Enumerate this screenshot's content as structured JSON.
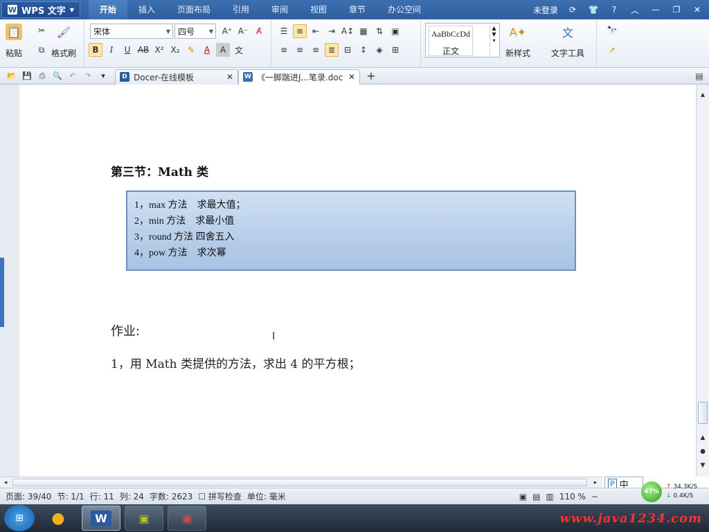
{
  "app": {
    "title": "WPS 文字"
  },
  "menu": {
    "tabs": [
      "开始",
      "插入",
      "页面布局",
      "引用",
      "审阅",
      "视图",
      "章节",
      "办公空间"
    ],
    "login": "未登录"
  },
  "ribbon": {
    "paste_label": "粘贴",
    "format_painter_label": "格式刷",
    "font_name": "宋体",
    "font_size": "四号",
    "style_preview": "AaBbCcDd",
    "style_name": "正文",
    "new_style_label": "新样式",
    "text_tools_label": "文字工具"
  },
  "doc_tabs": [
    {
      "label": "Docer-在线模板"
    },
    {
      "label": "《一脚踹进J...笔录.doc"
    }
  ],
  "document": {
    "section_title": "第三节：Math 类",
    "box_items": [
      "1，max 方法　求最大值；",
      "2，min 方法　求最小值",
      "3，round 方法  四舍五入",
      "4，pow 方法　求次幂"
    ],
    "homework_title": "作业:",
    "homework_items": [
      "1，用 Math 类提供的方法，求出 4 的平方根；"
    ]
  },
  "status_bar": {
    "page": "页面: 39/40",
    "section": "节: 1/1",
    "line": "行: 11",
    "column": "列: 24",
    "word_count": "字数: 2623",
    "spell_check": "拼写检查",
    "unit": "单位: 毫米",
    "zoom": "110 %"
  },
  "ime": {
    "lang": "中"
  },
  "network": {
    "percent": "47%",
    "up": "34.3K/S",
    "down": "0.4K/S"
  },
  "watermark": "www.java1234.com",
  "colors": {
    "menubar": "#3465a8",
    "box_fill": "#b8cfea",
    "box_border": "#6d8fbd"
  }
}
